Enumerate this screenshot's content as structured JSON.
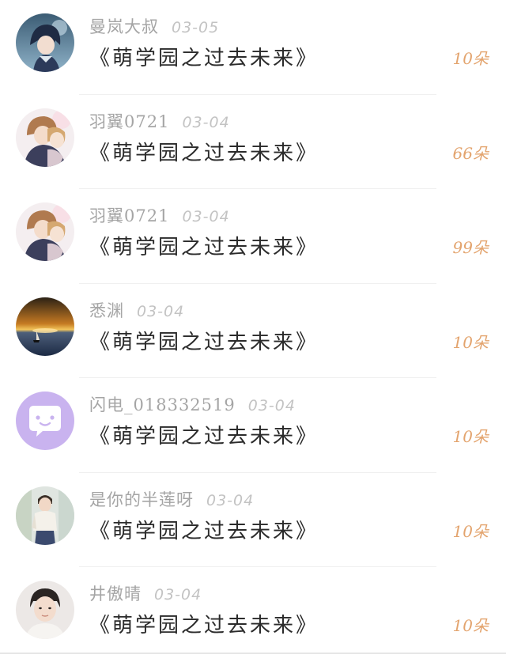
{
  "entries": [
    {
      "username": "曼岚大叔",
      "date": "03-05",
      "book": "《萌学园之过去未来》",
      "flowers": "10朵",
      "avatar": "anime-boy-dark-blue"
    },
    {
      "username": "羽翼0721",
      "date": "03-04",
      "book": "《萌学园之过去未来》",
      "flowers": "66朵",
      "avatar": "anime-couple"
    },
    {
      "username": "羽翼0721",
      "date": "03-04",
      "book": "《萌学园之过去未来》",
      "flowers": "99朵",
      "avatar": "anime-couple"
    },
    {
      "username": "悉渊",
      "date": "03-04",
      "book": "《萌学园之过去未来》",
      "flowers": "10朵",
      "avatar": "sunset-boat"
    },
    {
      "username": "闪电_018332519",
      "date": "03-04",
      "book": "《萌学园之过去未来》",
      "flowers": "10朵",
      "avatar": "default-chat-bubble"
    },
    {
      "username": "是你的半莲呀",
      "date": "03-04",
      "book": "《萌学园之过去未来》",
      "flowers": "10朵",
      "avatar": "boy-photo-standing"
    },
    {
      "username": "井傲晴",
      "date": "03-04",
      "book": "《萌学园之过去未来》",
      "flowers": "10朵",
      "avatar": "boy-photo-portrait"
    }
  ],
  "colors": {
    "username": "#a5a5a5",
    "date": "#c3c3c3",
    "book": "#2b2b2b",
    "flowers": "#e3a46e",
    "default_avatar_bg": "#c9b3ef"
  }
}
